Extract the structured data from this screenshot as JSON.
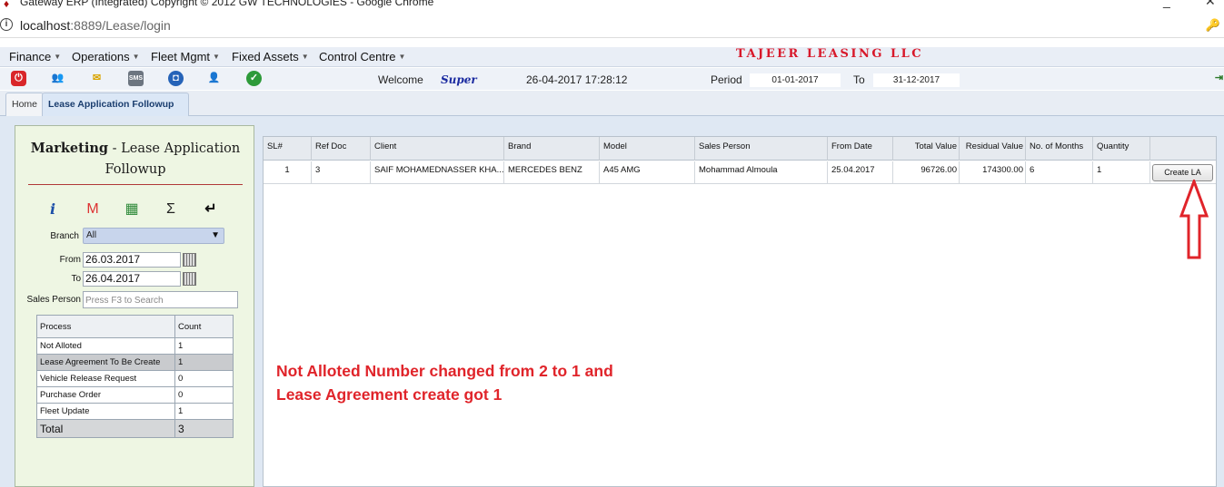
{
  "browser": {
    "title": "Gateway ERP (Integrated) Copyright © 2012 GW TECHNOLOGIES - Google Chrome",
    "url_host": "localhost",
    "url_rest": ":8889/Lease/login"
  },
  "menu": {
    "items": [
      "Finance",
      "Operations",
      "Fleet Mgmt",
      "Fixed Assets",
      "Control Centre"
    ],
    "company": "TAJEER LEASING LLC"
  },
  "toolbar": {
    "welcome_label": "Welcome",
    "user": "Super",
    "datetime": "26-04-2017 17:28:12",
    "period_label": "Period",
    "period_from": "01-01-2017",
    "to_label": "To",
    "period_to": "31-12-2017"
  },
  "tabs": [
    "Home",
    "Lease Application Followup"
  ],
  "left_panel": {
    "title_strong": "Marketing",
    "title_rest": " - Lease Application Followup",
    "branch_label": "Branch",
    "branch_value": "All",
    "from_label": "From",
    "from_value": "26.03.2017",
    "to_label": "To",
    "to_value": "26.04.2017",
    "sales_label": "Sales Person",
    "sales_placeholder": "Press F3 to Search",
    "process_header": "Process",
    "count_header": "Count",
    "processes": [
      {
        "name": "Not Alloted",
        "count": "1"
      },
      {
        "name": "Lease Agreement To Be Create",
        "count": "1"
      },
      {
        "name": "Vehicle Release Request",
        "count": "0"
      },
      {
        "name": "Purchase Order",
        "count": "0"
      },
      {
        "name": "Fleet Update",
        "count": "1"
      }
    ],
    "total_label": "Total",
    "total_value": "3"
  },
  "grid": {
    "headers": [
      "SL#",
      "Ref Doc",
      "Client",
      "Brand",
      "Model",
      "Sales Person",
      "From Date",
      "Total Value",
      "Residual Value",
      "No. of Months",
      "Quantity"
    ],
    "rows": [
      [
        "1",
        "3",
        "SAIF MOHAMEDNASSER KHA...",
        "MERCEDES BENZ",
        "A45 AMG",
        "Mohammad Almoula",
        "25.04.2017",
        "96726.00",
        "174300.00",
        "6",
        "1"
      ]
    ],
    "action_label": "Create LA"
  },
  "annotation": {
    "line1": "Not Alloted Number changed from 2 to 1 and",
    "line2": "Lease Agreement create got 1"
  }
}
